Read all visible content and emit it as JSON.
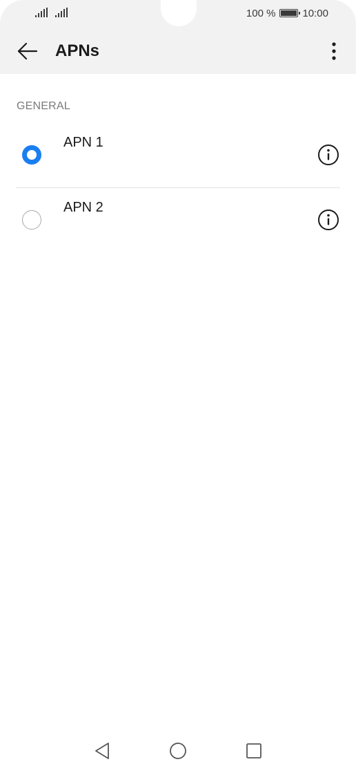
{
  "status_bar": {
    "battery_text": "100 %",
    "time": "10:00",
    "battery_level": 1.0
  },
  "app_bar": {
    "title": "APNs",
    "back_icon": "arrow-left-icon",
    "more_icon": "more-vertical-icon"
  },
  "section": {
    "header": "GENERAL"
  },
  "apns": [
    {
      "label": "APN 1",
      "selected": true
    },
    {
      "label": "APN 2",
      "selected": false
    }
  ],
  "colors": {
    "accent": "#1a7ef0",
    "app_bar_bg": "#f2f2f2"
  },
  "nav_bar": {
    "back_icon": "triangle-back-icon",
    "home_icon": "circle-home-icon",
    "recents_icon": "square-recents-icon"
  }
}
